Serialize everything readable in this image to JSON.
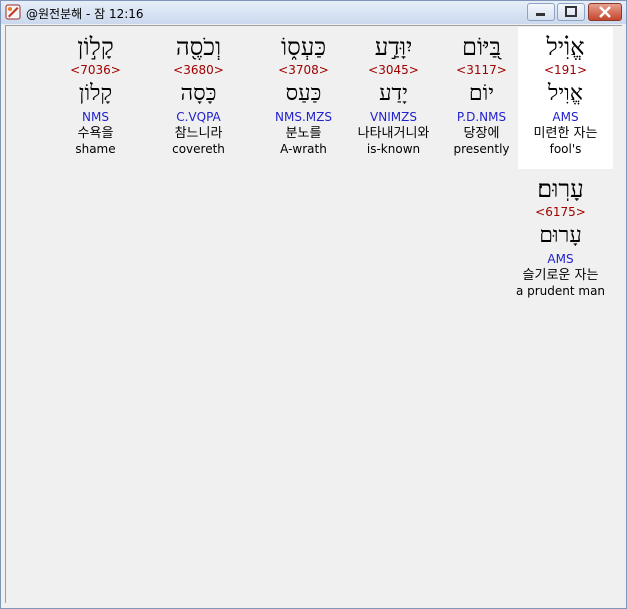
{
  "window": {
    "title": "@원전분해 - 잠 12:16"
  },
  "words": [
    {
      "hebrew": "אֱוִ֗יל",
      "strong": "<191>",
      "lemma": "אֱוִיל",
      "morph": "AMS",
      "korean": "미련한 자는",
      "english": "fool's"
    },
    {
      "hebrew": "בַּ֭יּוֹם",
      "strong": "<3117>",
      "lemma": "יוֹם",
      "morph": "P.D.NMS",
      "korean": "당장에",
      "english": "presently"
    },
    {
      "hebrew": "יִוָּדַ֣ע",
      "strong": "<3045>",
      "lemma": "יָדַע",
      "morph": "VNIMZS",
      "korean": "나타내거니와",
      "english": "is-known"
    },
    {
      "hebrew": "כַּעְס֑וֹ",
      "strong": "<3708>",
      "lemma": "כַּעַס",
      "morph": "NMS.MZS",
      "korean": "분노를",
      "english": "A-wrath"
    },
    {
      "hebrew": "וְכֹסֶ֖ה",
      "strong": "<3680>",
      "lemma": "כָּסָה",
      "morph": "C.VQPA",
      "korean": "참느니라",
      "english": "covereth"
    },
    {
      "hebrew": "קָל֣וֹן",
      "strong": "<7036>",
      "lemma": "קָלוֹן",
      "morph": "NMS",
      "korean": "수욕을",
      "english": "shame"
    },
    {
      "hebrew": "עָרֽוּם׃",
      "strong": "<6175>",
      "lemma": "עָרוּם",
      "morph": "AMS",
      "korean": "슬기로운 자는",
      "english": "a prudent man"
    }
  ]
}
